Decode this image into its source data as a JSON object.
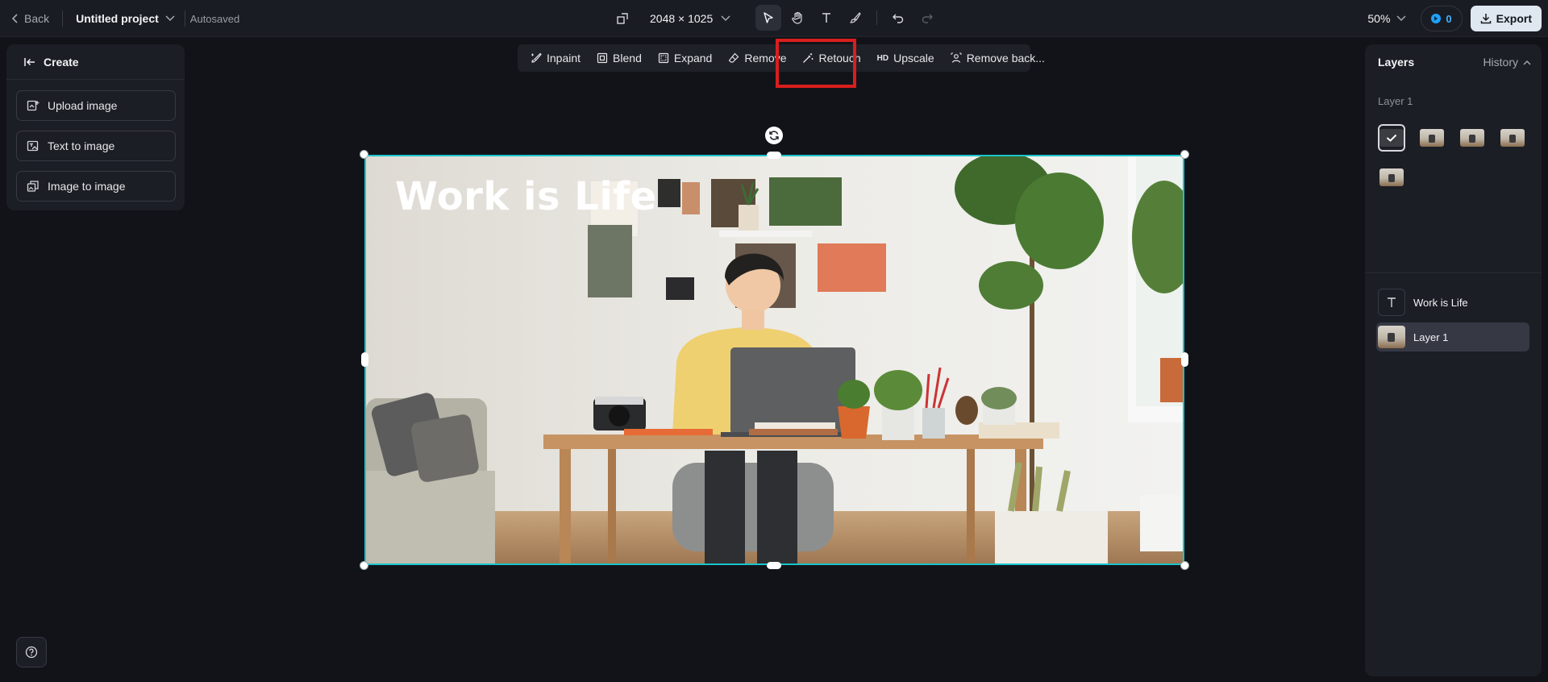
{
  "topbar": {
    "back_label": "Back",
    "project_name": "Untitled project",
    "autosaved": "Autosaved",
    "dimensions": "2048 × 1025",
    "zoom": "50%",
    "credits": "0",
    "export_label": "Export"
  },
  "left_panel": {
    "title": "Create",
    "buttons": [
      {
        "label": "Upload image"
      },
      {
        "label": "Text to image"
      },
      {
        "label": "Image to image"
      }
    ]
  },
  "edit_toolbar": {
    "items": [
      {
        "label": "Inpaint"
      },
      {
        "label": "Blend"
      },
      {
        "label": "Expand"
      },
      {
        "label": "Remove"
      },
      {
        "label": "Retouch",
        "highlighted": true
      },
      {
        "label": "Upscale",
        "badge": "HD"
      },
      {
        "label": "Remove back..."
      }
    ]
  },
  "canvas": {
    "text": "Work is Life"
  },
  "right_panel": {
    "tabs": {
      "layers": "Layers",
      "history": "History"
    },
    "subtitle": "Layer 1",
    "layers": [
      {
        "name": "Work is Life",
        "type": "text"
      },
      {
        "name": "Layer 1",
        "type": "image",
        "selected": true
      }
    ]
  },
  "colors": {
    "accent_selection": "#19c5cc",
    "highlight_box": "#d91e1e",
    "credits_blue": "#1ea2ff"
  }
}
